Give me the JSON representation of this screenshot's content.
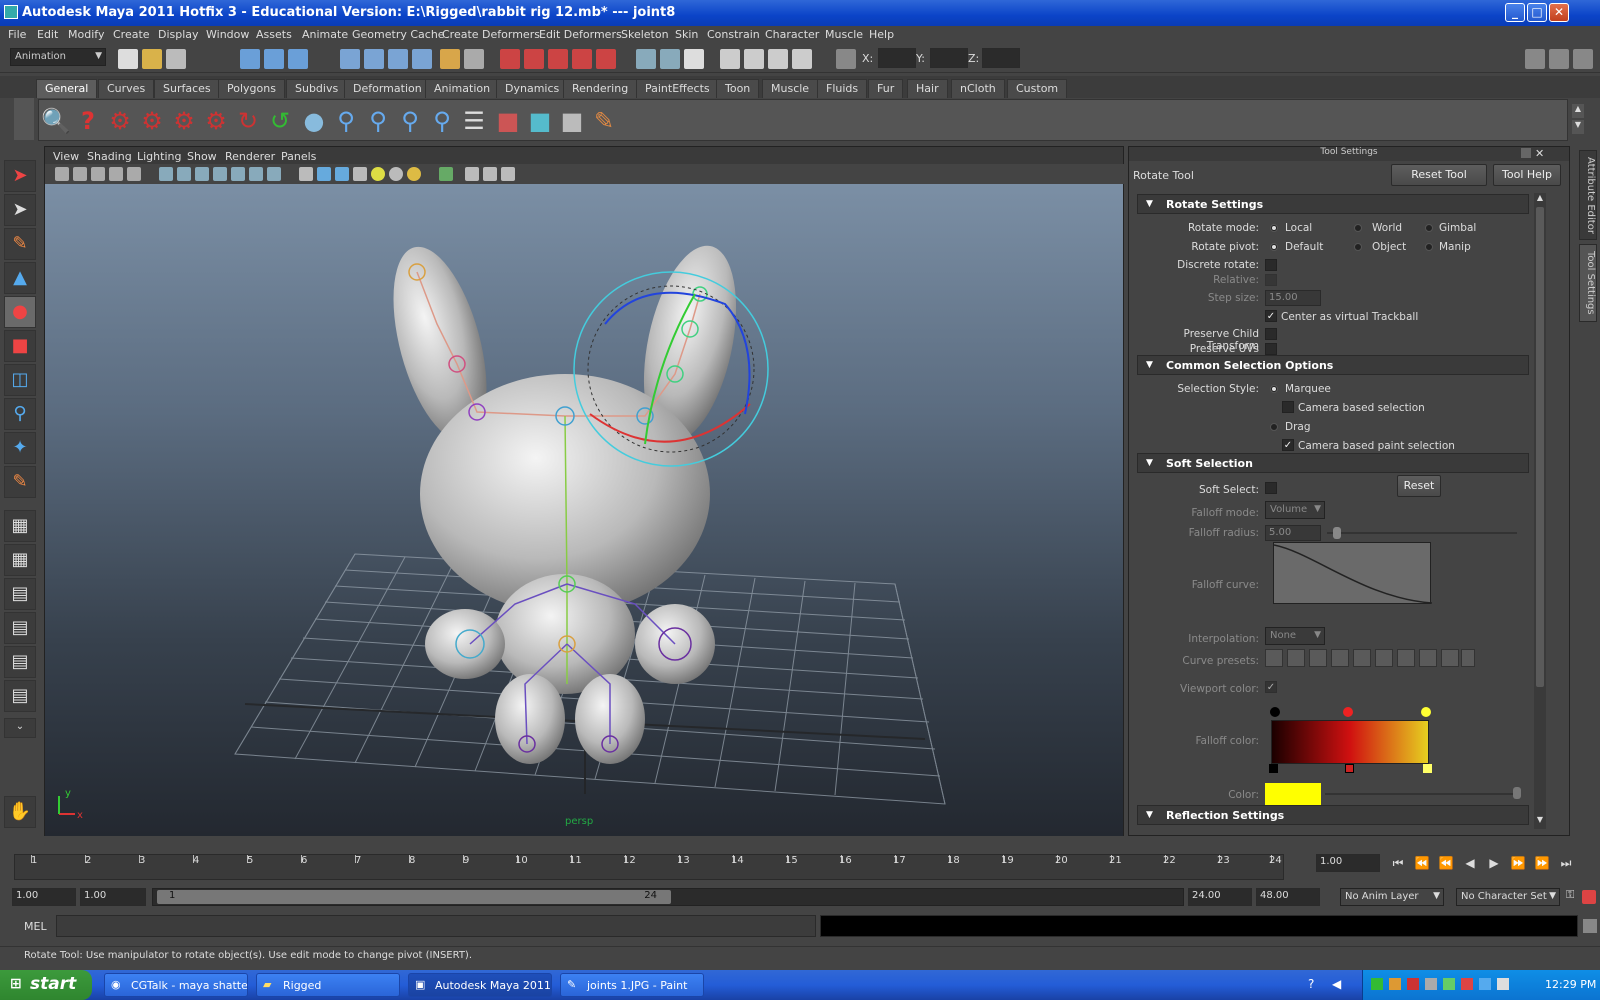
{
  "window": {
    "title": "Autodesk Maya 2011 Hotfix 3 - Educational Version: E:\\Rigged\\rabbit rig 12.mb*    ---    joint8"
  },
  "menubar": [
    "File",
    "Edit",
    "Modify",
    "Create",
    "Display",
    "Window",
    "Assets",
    "Animate",
    "Geometry Cache",
    "Create Deformers",
    "Edit Deformers",
    "Skeleton",
    "Skin",
    "Constrain",
    "Character",
    "Muscle",
    "Help"
  ],
  "statusline": {
    "mode": "Animation",
    "x_label": "X:",
    "y_label": "Y:",
    "z_label": "Z:"
  },
  "shelf_tabs": [
    "General",
    "Curves",
    "Surfaces",
    "Polygons",
    "Subdivs",
    "Deformation",
    "Animation",
    "Dynamics",
    "Rendering",
    "PaintEffects",
    "Toon",
    "Muscle",
    "Fluids",
    "Fur",
    "Hair",
    "nCloth",
    "Custom"
  ],
  "panel_menu": [
    "View",
    "Shading",
    "Lighting",
    "Show",
    "Renderer",
    "Panels"
  ],
  "viewport": {
    "camera_label": "persp",
    "axis_x": "x",
    "axis_y": "y"
  },
  "tool_settings": {
    "panel_title": "Tool Settings",
    "tool_name": "Rotate Tool",
    "reset_tool": "Reset Tool",
    "tool_help": "Tool Help",
    "rotate_settings": {
      "header": "Rotate Settings",
      "rotate_mode_label": "Rotate mode:",
      "rotate_mode_options": [
        "Local",
        "World",
        "Gimbal"
      ],
      "rotate_pivot_label": "Rotate pivot:",
      "rotate_pivot_options": [
        "Default",
        "Object",
        "Manip"
      ],
      "discrete_rotate": "Discrete rotate:",
      "relative": "Relative:",
      "step_size_label": "Step size:",
      "step_size_value": "15.00",
      "center_trackball": "Center as virtual Trackball",
      "preserve_child": "Preserve Child Transform",
      "preserve_uvs": "Preserve UVs"
    },
    "common_selection": {
      "header": "Common Selection Options",
      "selection_style_label": "Selection Style:",
      "marquee": "Marquee",
      "camera_based_selection": "Camera based selection",
      "drag": "Drag",
      "camera_based_paint": "Camera based paint selection"
    },
    "soft_selection": {
      "header": "Soft Selection",
      "soft_select_label": "Soft Select:",
      "reset": "Reset",
      "falloff_mode_label": "Falloff mode:",
      "falloff_mode_value": "Volume",
      "falloff_radius_label": "Falloff radius:",
      "falloff_radius_value": "5.00",
      "falloff_curve_label": "Falloff curve:",
      "interpolation_label": "Interpolation:",
      "interpolation_value": "None",
      "curve_presets_label": "Curve presets:",
      "viewport_color_label": "Viewport color:",
      "falloff_color_label": "Falloff color:",
      "color_label": "Color:",
      "color_value": "#ffff00"
    },
    "reflection": {
      "header": "Reflection Settings"
    }
  },
  "side_tabs": [
    "Attribute Editor",
    "Tool Settings"
  ],
  "timeline": {
    "ticks": [
      "1",
      "2",
      "3",
      "4",
      "5",
      "6",
      "7",
      "8",
      "9",
      "10",
      "11",
      "12",
      "13",
      "14",
      "15",
      "16",
      "17",
      "18",
      "19",
      "20",
      "21",
      "22",
      "23",
      "24"
    ],
    "current_time": "1.00"
  },
  "range": {
    "start": "1.00",
    "playback_start": "1.00",
    "slider_start": "1",
    "slider_end": "24",
    "playback_end": "24.00",
    "end": "48.00",
    "anim_layer": "No Anim Layer",
    "character_set": "No Character Set"
  },
  "command_line": {
    "label": "MEL"
  },
  "help_line": "Rotate Tool: Use manipulator to rotate object(s). Use edit mode to change pivot (INSERT).",
  "taskbar": {
    "start": "start",
    "tasks": [
      "CGTalk - maya shatte...",
      "Rigged",
      "Autodesk Maya 2011 ...",
      "joints 1.JPG - Paint"
    ],
    "clock": "12:29 PM"
  },
  "colors": {
    "accent_blue": "#245dd7",
    "maya_panel": "#444444",
    "soft_select_color": "#ffff00"
  }
}
